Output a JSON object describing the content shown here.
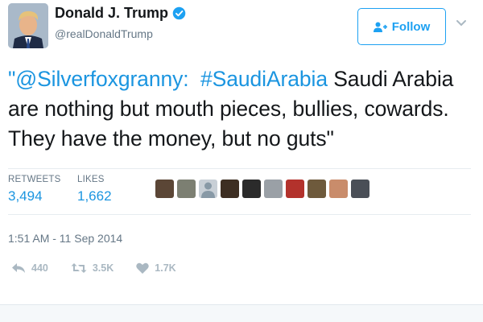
{
  "user": {
    "display_name": "Donald J. Trump",
    "handle": "@realDonaldTrump",
    "verified": true
  },
  "follow_button": {
    "label": "Follow"
  },
  "tweet": {
    "mention": "\"@Silverfoxgranny:",
    "hashtag": "#SaudiArabia",
    "body": " Saudi Arabia are nothing but mouth pieces, bullies, cowards. They have the money, but no guts\""
  },
  "stats": {
    "retweets_label": "RETWEETS",
    "retweets_value": "3,494",
    "likes_label": "LIKES",
    "likes_value": "1,662"
  },
  "timestamp": "1:51 AM - 11 Sep 2014",
  "actions": {
    "reply_count": "440",
    "retweet_count": "3.5K",
    "like_count": "1.7K"
  },
  "colors": {
    "link_blue": "#1b95e0",
    "follow_blue": "#1da1f2",
    "muted_gray": "#657786",
    "icon_gray": "#aab8c2"
  }
}
